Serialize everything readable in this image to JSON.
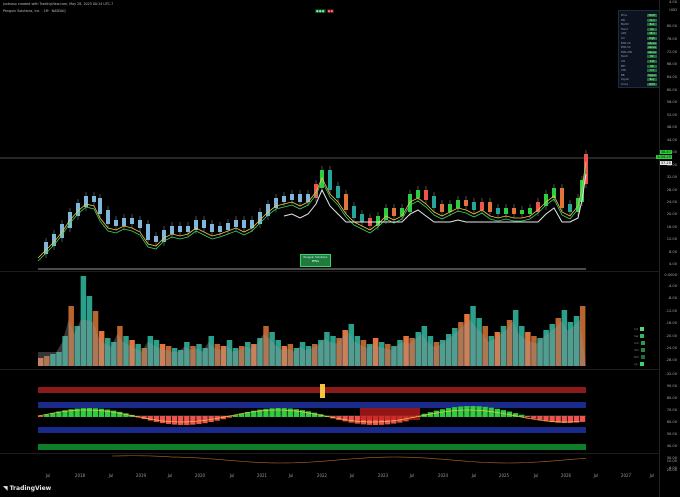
{
  "header": {
    "line1": "justnasx created with TradingView.com, May 28, 2025 00:24 UTC-7",
    "line2": "Penguin Solutions, Inc. · 1M · NASDAQ"
  },
  "price_axis": {
    "ticks": [
      "USD",
      "80.00",
      "76.00",
      "72.00",
      "68.00",
      "64.00",
      "60.00",
      "56.00",
      "52.00",
      "48.00",
      "44.00",
      "40.00",
      "36.00",
      "32.00",
      "28.00",
      "24.00",
      "20.00",
      "16.00",
      "12.00",
      "8.00",
      "4.00",
      "0.0000",
      "-4.00",
      "-8.00",
      "-12.00",
      "-16.00",
      "-20.00",
      "-24.00",
      "-28.00",
      "-32.00",
      "90.00",
      "80.00",
      "70.00",
      "60.00",
      "50.00",
      "40.00",
      "30.00",
      "20.00",
      "10.00",
      "6.00",
      "4.00"
    ],
    "last_price": "38.87",
    "last_price_sub": "3:04:29",
    "level_tag": "37.20"
  },
  "time_axis": {
    "labels": [
      "Jul",
      "2018",
      "Jul",
      "2019",
      "Jul",
      "2020",
      "Jul",
      "2021",
      "Jul",
      "2022",
      "Jul",
      "2023",
      "Jul",
      "2024",
      "Jul",
      "2025",
      "Jul",
      "2026",
      "Jul",
      "2027",
      "Jul"
    ]
  },
  "callout": {
    "line1": "Penguin Solutions",
    "line2": "PENG"
  },
  "info_table": {
    "rows": [
      {
        "label": "Price",
        "value": "38.87"
      },
      {
        "label": "RSI",
        "value": "71.2"
      },
      {
        "label": "MACD",
        "value": "Bull"
      },
      {
        "label": "Trend",
        "value": "Up"
      },
      {
        "label": "ADX",
        "value": "28.4"
      },
      {
        "label": "Vol",
        "value": "High"
      },
      {
        "label": "EMA 20",
        "value": "Above"
      },
      {
        "label": "EMA 50",
        "value": "Above"
      },
      {
        "label": "EMA 200",
        "value": "Above"
      },
      {
        "label": "Stoch",
        "value": "82"
      },
      {
        "label": "CCI",
        "value": "140"
      },
      {
        "label": "MFI",
        "value": "68"
      },
      {
        "label": "ATR",
        "value": "3.1"
      },
      {
        "label": "BB",
        "value": "Upper"
      },
      {
        "label": "Signal",
        "value": "Buy"
      },
      {
        "label": "Score",
        "value": "8/10"
      }
    ]
  },
  "volume_legend": [
    "1d",
    "1w",
    "1m",
    "3m",
    "6m",
    "1y"
  ],
  "brand": "TradingView",
  "colors": {
    "up": "#26a69a",
    "down": "#ef5350",
    "green": "#2ecc40",
    "orange": "#e0743a",
    "red_band": "#8b1a1a",
    "blue_band": "#1a2a8b",
    "green_band": "#0f7d2a"
  }
}
